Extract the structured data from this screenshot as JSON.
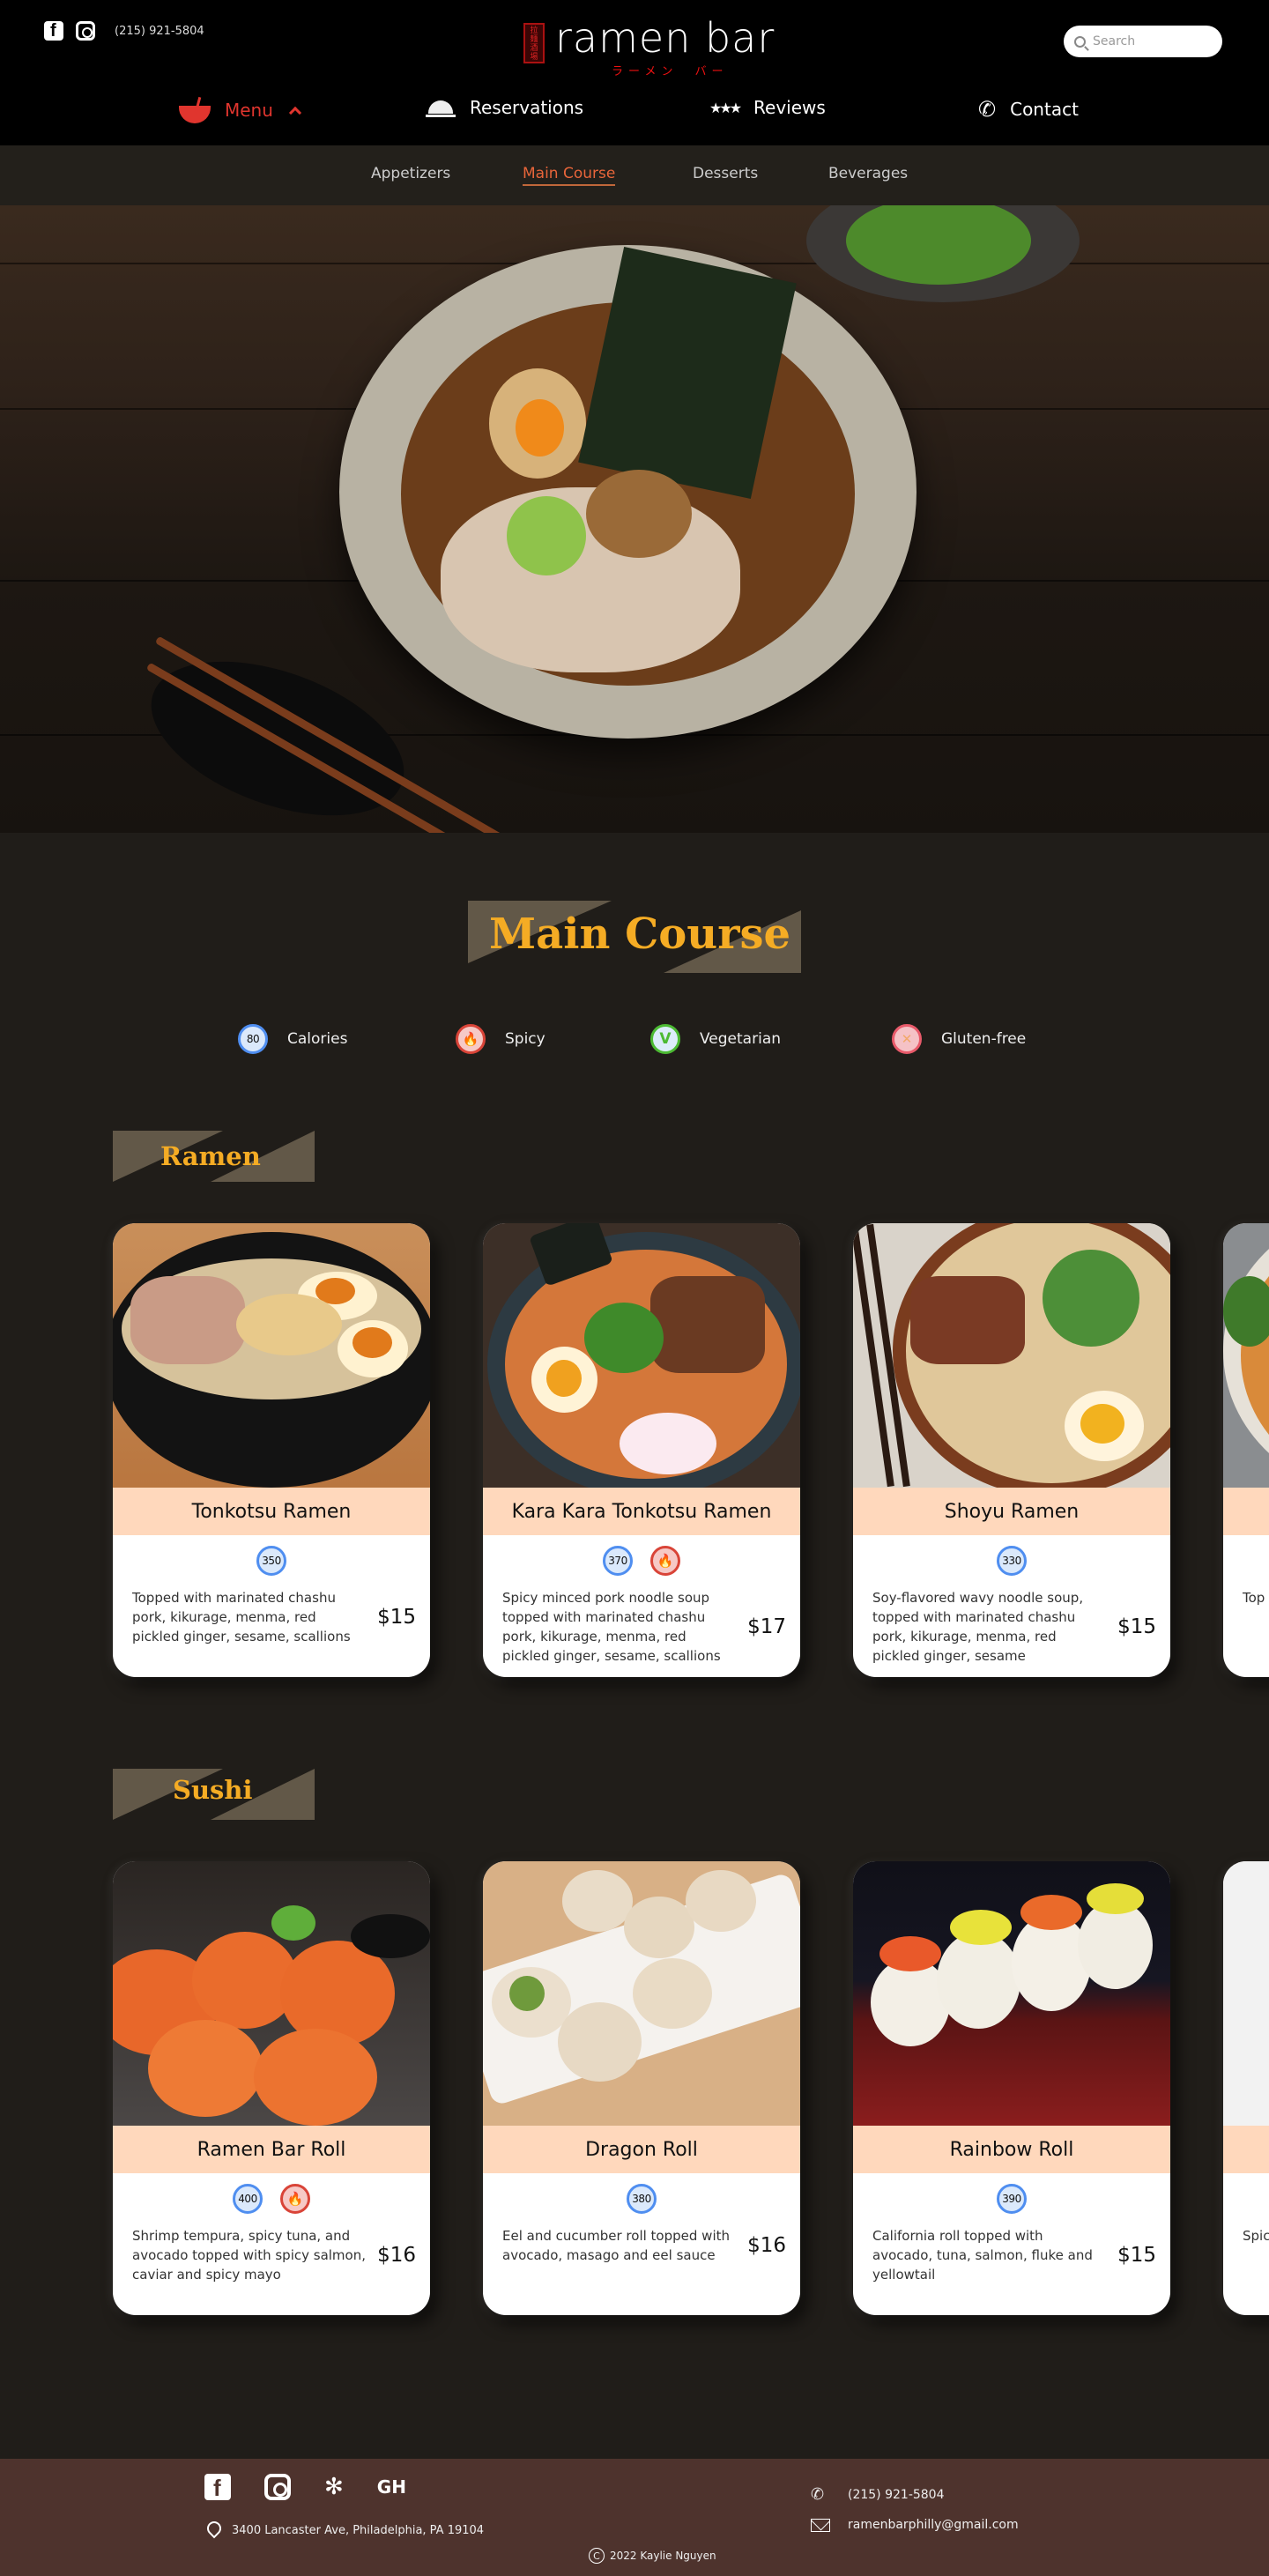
{
  "header": {
    "phone": "(215) 921-5804",
    "social": [
      "facebook-icon",
      "instagram-icon"
    ],
    "logo": {
      "text": "ramen bar",
      "stamp": "拉麺酒場",
      "subtitle": "ラーメン　バー"
    },
    "search": {
      "placeholder": "Search",
      "value": ""
    }
  },
  "nav": {
    "items": [
      {
        "label": "Menu",
        "icon": "ramen-bowl-icon",
        "active": true,
        "expanded": true
      },
      {
        "label": "Reservations",
        "icon": "cloche-icon"
      },
      {
        "label": "Reviews",
        "icon": "stars-icon"
      },
      {
        "label": "Contact",
        "icon": "phone-icon"
      }
    ]
  },
  "subnav": {
    "items": [
      {
        "label": "Appetizers"
      },
      {
        "label": "Main Course",
        "active": true
      },
      {
        "label": "Desserts"
      },
      {
        "label": "Beverages"
      }
    ]
  },
  "page": {
    "title": "Main Course"
  },
  "legend": {
    "items": [
      {
        "badge": "80",
        "label": "Calories",
        "type": "calories"
      },
      {
        "badge": "🔥",
        "label": "Spicy",
        "type": "spicy"
      },
      {
        "badge": "V",
        "label": "Vegetarian",
        "type": "vegetarian"
      },
      {
        "badge": "✕",
        "label": "Gluten-free",
        "type": "gluten-free"
      }
    ]
  },
  "colors": {
    "accent_red": "#e0352e",
    "active_subnav": "#e8653a",
    "title_gold": "#f5ac24",
    "banner_bg": "#625848",
    "card_name_bg": "#ffd8bc",
    "page_bg": "#201d19",
    "footer_bg": "#4e332d"
  },
  "sections": [
    {
      "title": "Ramen",
      "items": [
        {
          "name": "Tonkotsu Ramen",
          "calories": "350",
          "spicy": false,
          "description": "Topped with marinated chashu pork, kikurage, menma, red pickled ginger, sesame, scallions",
          "price": "$15"
        },
        {
          "name": "Kara Kara Tonkotsu Ramen",
          "calories": "370",
          "spicy": true,
          "spicy_icon": "🔥",
          "description": "Spicy minced pork noodle soup topped with marinated chashu pork, kikurage, menma, red pickled ginger, sesame, scallions",
          "price": "$17"
        },
        {
          "name": "Shoyu Ramen",
          "calories": "330",
          "spicy": false,
          "description": "Soy-flavored wavy noodle soup, topped with marinated chashu pork, kikurage, menma, red pickled ginger, sesame",
          "price": "$15"
        },
        {
          "name": "",
          "calories": "",
          "spicy": false,
          "description": "Top por nar sca",
          "price": ""
        }
      ]
    },
    {
      "title": "Sushi",
      "items": [
        {
          "name": "Ramen Bar Roll",
          "calories": "400",
          "spicy": true,
          "spicy_icon": "🔥",
          "description": "Shrimp tempura, spicy tuna, and avocado topped with spicy salmon, caviar and spicy mayo",
          "price": "$16"
        },
        {
          "name": "Dragon Roll",
          "calories": "380",
          "spicy": false,
          "description": "Eel and cucumber roll topped with avocado, masago and eel sauce",
          "price": "$16"
        },
        {
          "name": "Rainbow Roll",
          "calories": "390",
          "spicy": false,
          "description": "California roll topped with avocado, tuna, salmon, fluke and yellowtail",
          "price": "$15"
        },
        {
          "name": "",
          "calories": "",
          "spicy": false,
          "description": "Spic cuc salm",
          "price": ""
        }
      ]
    }
  ],
  "footer": {
    "social": [
      "facebook-icon",
      "instagram-icon",
      "yelp-icon",
      "grubhub-icon"
    ],
    "address": "3400 Lancaster Ave, Philadelphia, PA 19104",
    "phone": "(215) 921-5804",
    "email": "ramenbarphilly@gmail.com",
    "copyright": "2022 Kaylie Nguyen"
  }
}
